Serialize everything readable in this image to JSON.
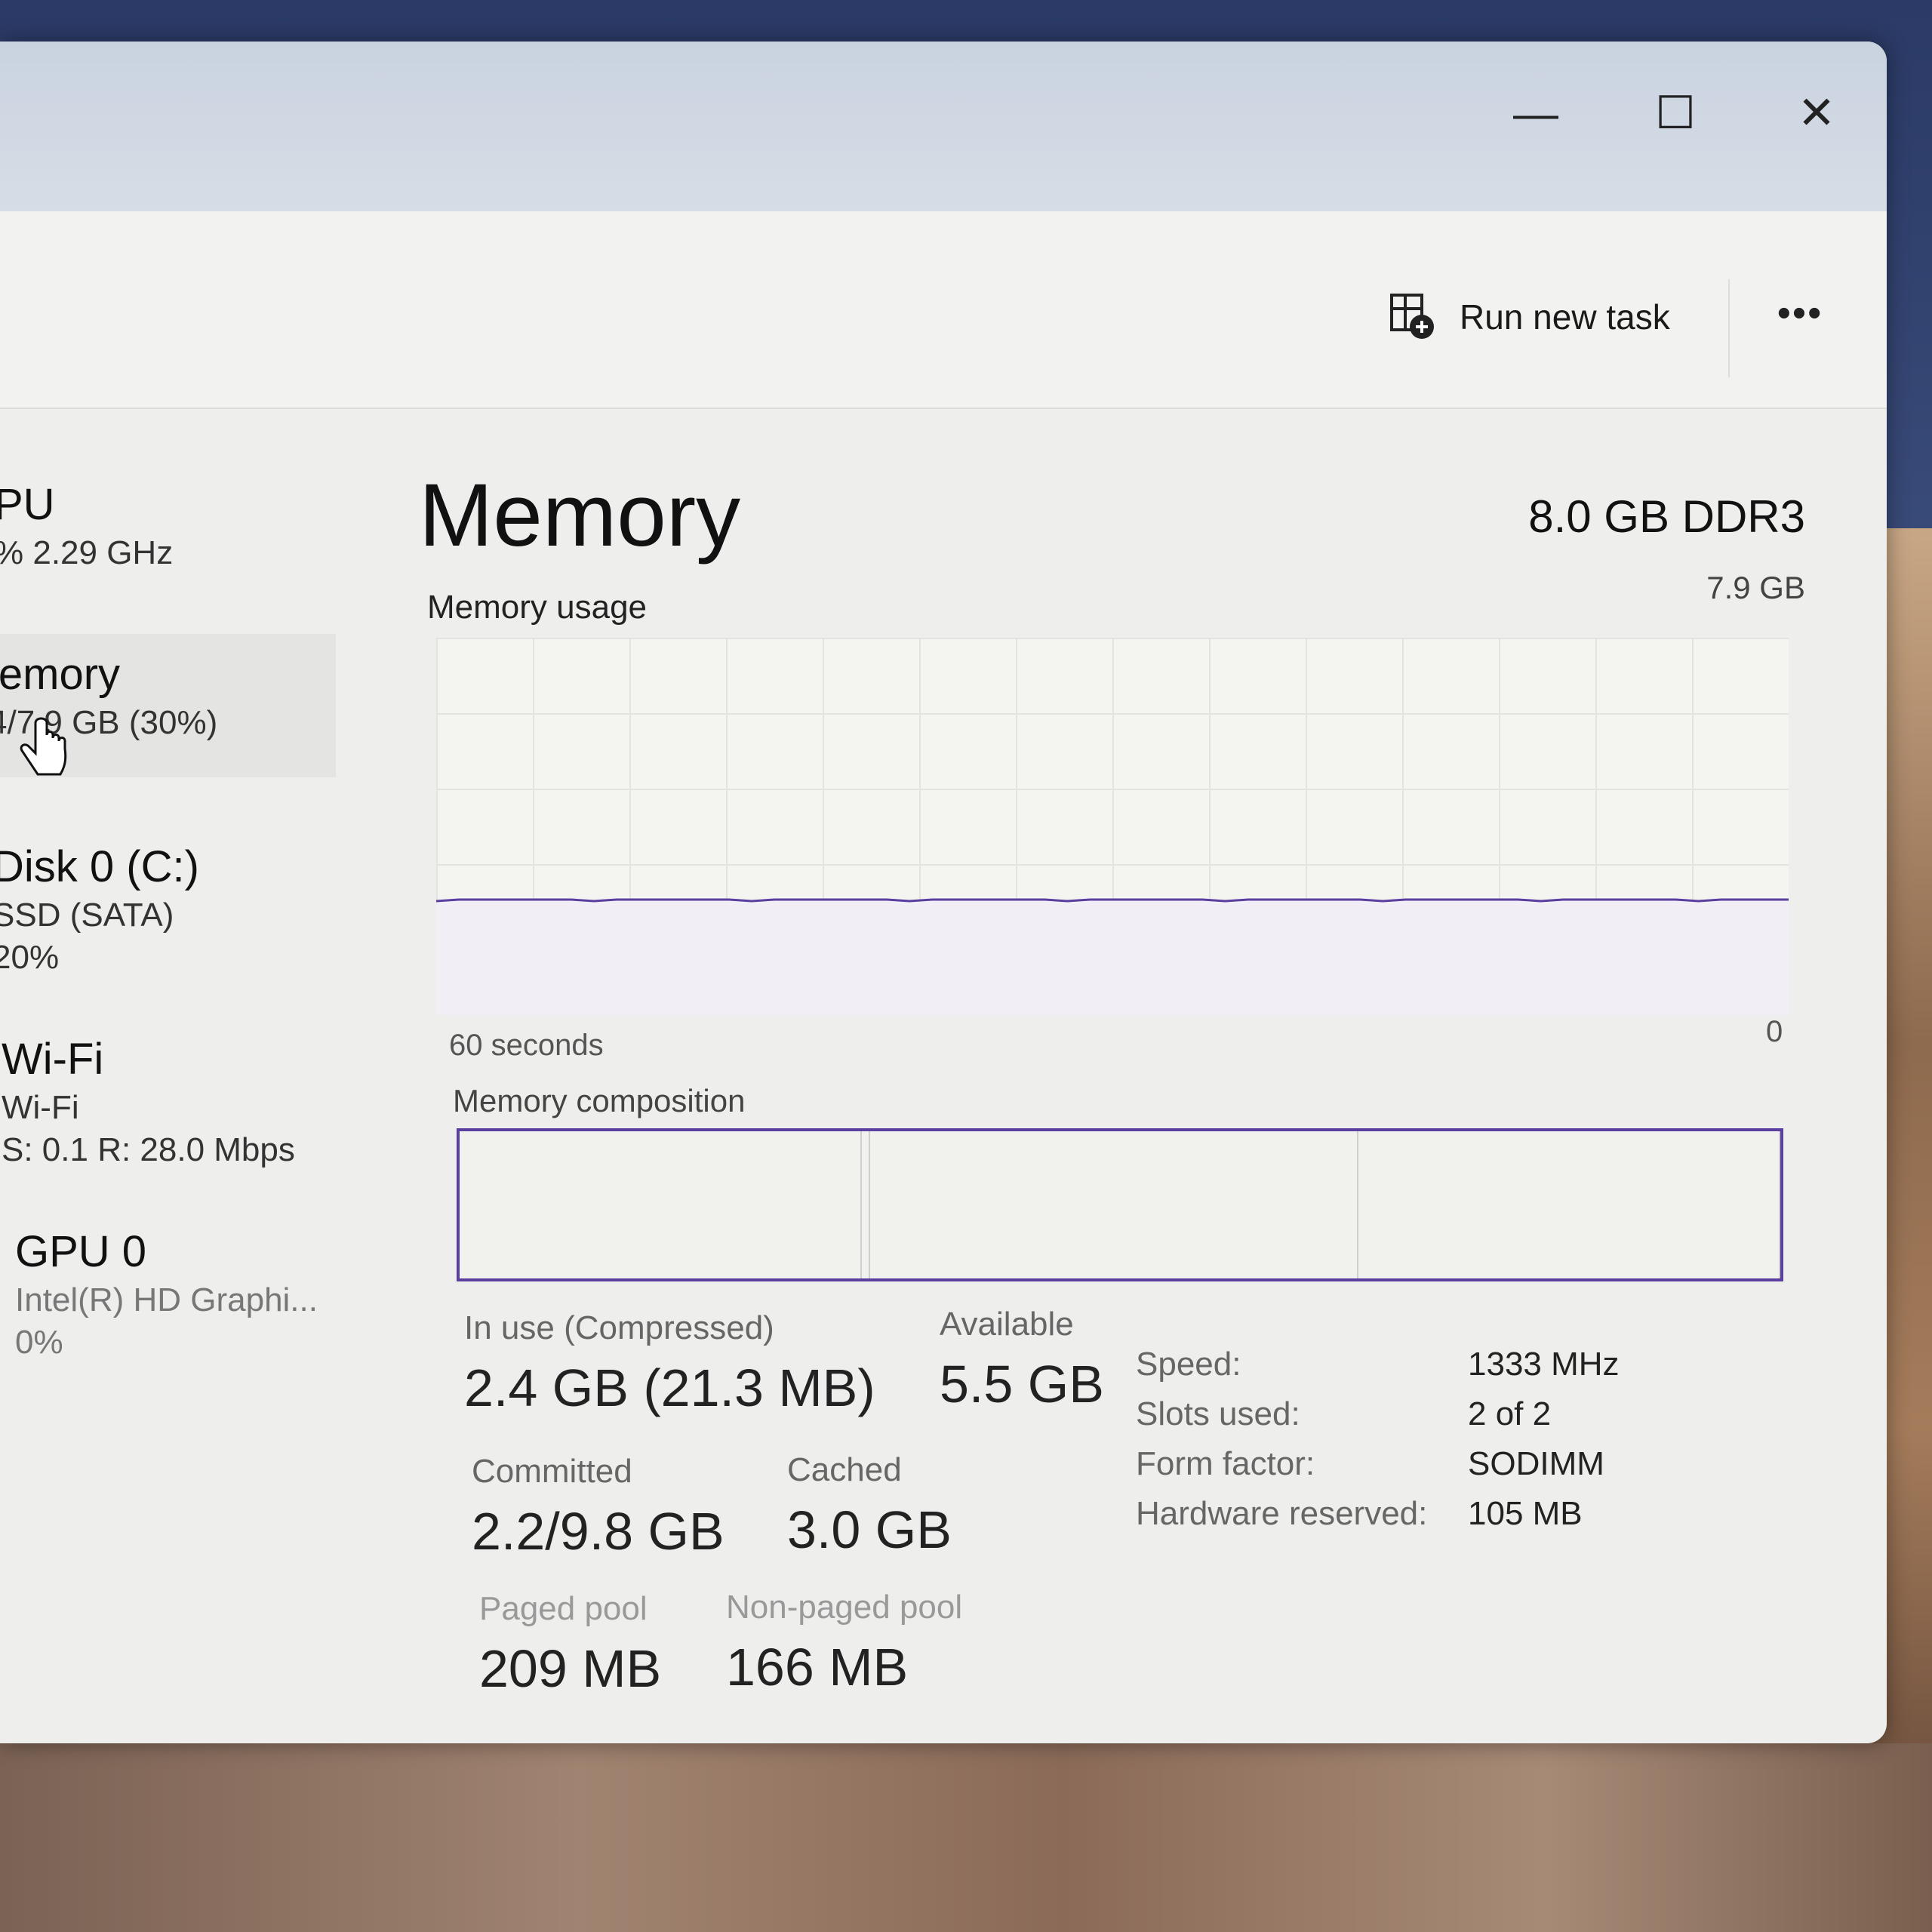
{
  "window": {
    "controls": {
      "minimize": "—",
      "maximize": "☐",
      "close": "✕"
    }
  },
  "toolbar": {
    "run_new_task": "Run new task",
    "more": "•••"
  },
  "sidebar": {
    "items": [
      {
        "title": "PU",
        "line1": "% 2.29 GHz"
      },
      {
        "title": "lemory",
        "line1": "4/7.9 GB (30%)"
      },
      {
        "title": "Disk 0 (C:)",
        "line1": "SSD (SATA)",
        "line2": "20%"
      },
      {
        "title": "Wi-Fi",
        "line1": "Wi-Fi",
        "line2": "S: 0.1 R: 28.0 Mbps"
      },
      {
        "title": "GPU 0",
        "line1": "Intel(R) HD Graphi...",
        "line2": "0%"
      }
    ]
  },
  "main": {
    "title": "Memory",
    "total": "8.0 GB DDR3",
    "usage_label": "Memory usage",
    "max_value": "7.9 GB",
    "axis_left": "60 seconds",
    "axis_right": "0",
    "composition_label": "Memory composition",
    "usage_fraction": 0.3,
    "composition": [
      {
        "name": "in-use",
        "fraction": 0.305
      },
      {
        "name": "modified",
        "fraction": 0.005
      },
      {
        "name": "standby",
        "fraction": 0.37
      },
      {
        "name": "free",
        "fraction": 0.32
      }
    ]
  },
  "stats": {
    "in_use": {
      "label": "In use (Compressed)",
      "value": "2.4 GB (21.3 MB)"
    },
    "available": {
      "label": "Available",
      "value": "5.5 GB"
    },
    "committed": {
      "label": "Committed",
      "value": "2.2/9.8 GB"
    },
    "cached": {
      "label": "Cached",
      "value": "3.0 GB"
    },
    "paged_pool": {
      "label": "Paged pool",
      "value": "209 MB"
    },
    "non_paged_pool": {
      "label": "Non-paged pool",
      "value": "166 MB"
    }
  },
  "details": {
    "speed": {
      "label": "Speed:",
      "value": "1333 MHz"
    },
    "slots": {
      "label": "Slots used:",
      "value": "2 of 2"
    },
    "form": {
      "label": "Form factor:",
      "value": "SODIMM"
    },
    "reserved": {
      "label": "Hardware reserved:",
      "value": "105 MB"
    }
  },
  "colors": {
    "accent": "#5b3fa0",
    "window_bg": "#eeefec"
  }
}
